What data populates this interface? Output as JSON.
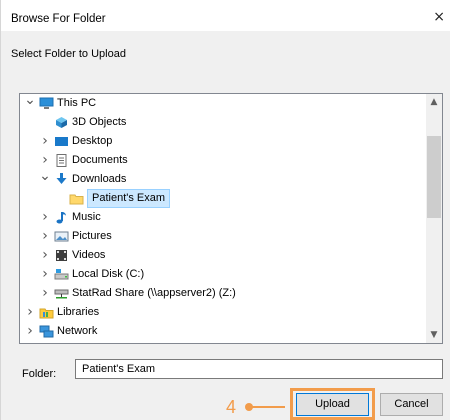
{
  "window": {
    "title": "Browse For Folder",
    "close": "×"
  },
  "instruction": "Select Folder to Upload",
  "tree": [
    {
      "label": "This PC",
      "chevron": "v",
      "icon": "this-pc-icon",
      "depth": 0
    },
    {
      "label": "3D Objects",
      "chevron": "",
      "icon": "3d-objects-icon",
      "depth": 1
    },
    {
      "label": "Desktop",
      "chevron": ">",
      "icon": "desktop-icon",
      "depth": 1
    },
    {
      "label": "Documents",
      "chevron": ">",
      "icon": "documents-icon",
      "depth": 1
    },
    {
      "label": "Downloads",
      "chevron": "v",
      "icon": "downloads-icon",
      "depth": 1
    },
    {
      "label": "Patient's Exam",
      "chevron": "",
      "icon": "folder-icon",
      "depth": 2,
      "selected": true
    },
    {
      "label": "Music",
      "chevron": ">",
      "icon": "music-icon",
      "depth": 1
    },
    {
      "label": "Pictures",
      "chevron": ">",
      "icon": "pictures-icon",
      "depth": 1
    },
    {
      "label": "Videos",
      "chevron": ">",
      "icon": "videos-icon",
      "depth": 1
    },
    {
      "label": "Local Disk (C:)",
      "chevron": ">",
      "icon": "local-disk-icon",
      "depth": 1
    },
    {
      "label": "StatRad Share (\\\\appserver2) (Z:)",
      "chevron": ">",
      "icon": "network-drive-icon",
      "depth": 1
    },
    {
      "label": "Libraries",
      "chevron": ">",
      "icon": "libraries-icon",
      "depth": 0
    },
    {
      "label": "Network",
      "chevron": ">",
      "icon": "network-icon",
      "depth": 0
    }
  ],
  "folder": {
    "label": "Folder:",
    "value": "Patient's Exam"
  },
  "buttons": {
    "upload": "Upload",
    "cancel": "Cancel"
  },
  "callout": {
    "step": "4",
    "color": "#f29c4b"
  },
  "colors": {
    "selection": "#cce8ff",
    "accent": "#0078d7"
  }
}
